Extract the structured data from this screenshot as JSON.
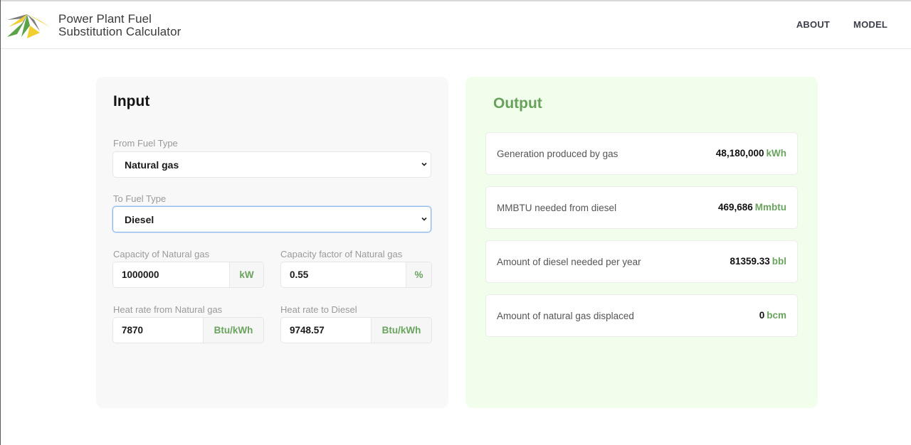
{
  "app": {
    "title_line1": "Power Plant Fuel",
    "title_line2": "Substitution Calculator"
  },
  "nav": {
    "items": [
      {
        "label": "ABOUT"
      },
      {
        "label": "MODEL"
      }
    ]
  },
  "colors": {
    "accent_green": "#6aa35e",
    "output_bg": "#f2feec",
    "input_bg": "#f8f8f8",
    "logo_green": "#5aa447",
    "logo_yellow": "#f2cf2f",
    "logo_gray": "#7d7d7d"
  },
  "input": {
    "title": "Input",
    "from_fuel": {
      "label": "From Fuel Type",
      "value": "Natural gas"
    },
    "to_fuel": {
      "label": "To Fuel Type",
      "value": "Diesel"
    },
    "capacity": {
      "label": "Capacity of Natural gas",
      "value": "1000000",
      "unit": "kW"
    },
    "capacity_factor": {
      "label": "Capacity factor of Natural gas",
      "value": "0.55",
      "unit": "%"
    },
    "heat_rate_from": {
      "label": "Heat rate from Natural gas",
      "value": "7870",
      "unit": "Btu/kWh"
    },
    "heat_rate_to": {
      "label": "Heat rate to Diesel",
      "value": "9748.57",
      "unit": "Btu/kWh"
    }
  },
  "output": {
    "title": "Output",
    "rows": [
      {
        "label": "Generation produced by gas",
        "value": "48,180,000",
        "unit": "kWh"
      },
      {
        "label": "MMBTU needed from diesel",
        "value": "469,686",
        "unit": "Mmbtu"
      },
      {
        "label": "Amount of diesel needed per year",
        "value": "81359.33",
        "unit": "bbl"
      },
      {
        "label": "Amount of natural gas displaced",
        "value": "0",
        "unit": "bcm"
      }
    ]
  }
}
